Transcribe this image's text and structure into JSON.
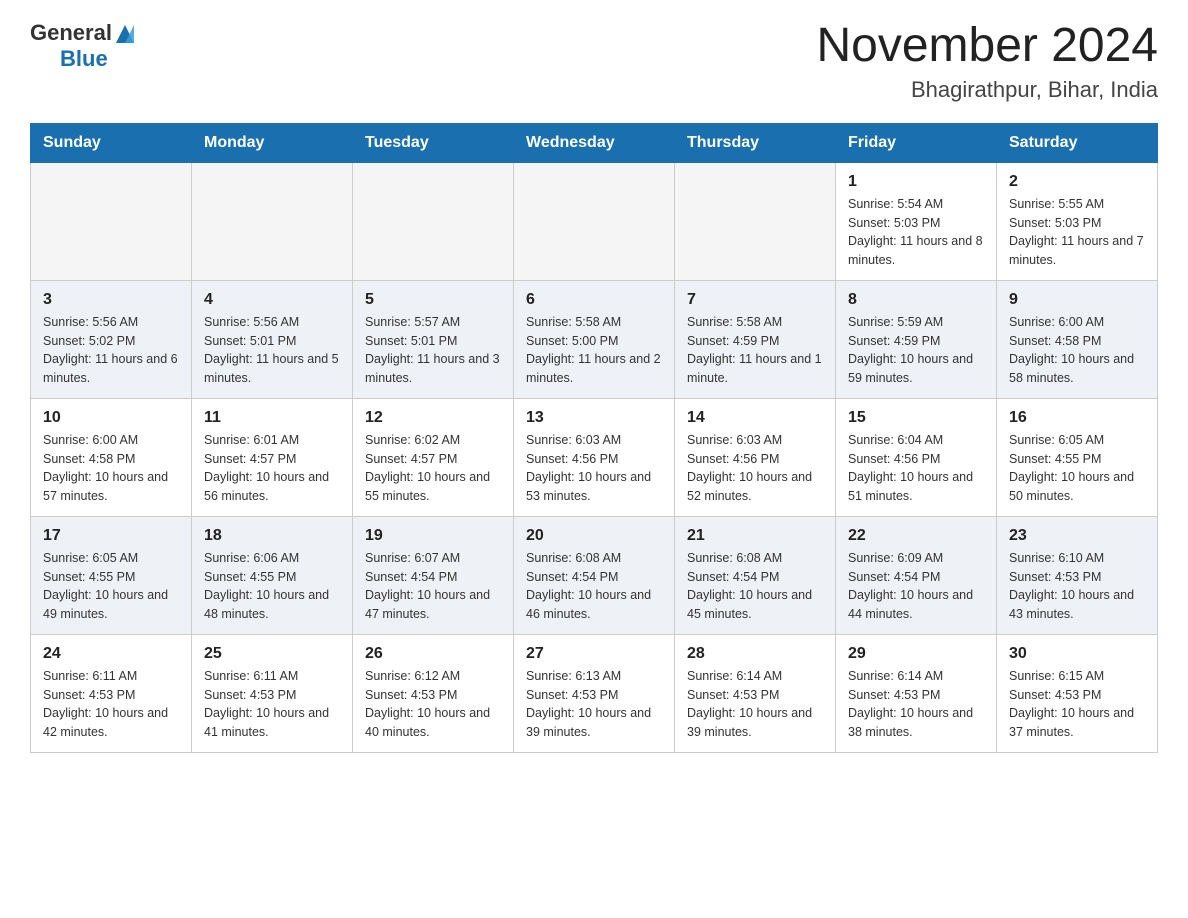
{
  "header": {
    "logo": {
      "general": "General",
      "blue": "Blue"
    },
    "title": "November 2024",
    "subtitle": "Bhagirathpur, Bihar, India"
  },
  "weekdays": [
    "Sunday",
    "Monday",
    "Tuesday",
    "Wednesday",
    "Thursday",
    "Friday",
    "Saturday"
  ],
  "weeks": [
    [
      {
        "day": "",
        "sunrise": "",
        "sunset": "",
        "daylight": ""
      },
      {
        "day": "",
        "sunrise": "",
        "sunset": "",
        "daylight": ""
      },
      {
        "day": "",
        "sunrise": "",
        "sunset": "",
        "daylight": ""
      },
      {
        "day": "",
        "sunrise": "",
        "sunset": "",
        "daylight": ""
      },
      {
        "day": "",
        "sunrise": "",
        "sunset": "",
        "daylight": ""
      },
      {
        "day": "1",
        "sunrise": "Sunrise: 5:54 AM",
        "sunset": "Sunset: 5:03 PM",
        "daylight": "Daylight: 11 hours and 8 minutes."
      },
      {
        "day": "2",
        "sunrise": "Sunrise: 5:55 AM",
        "sunset": "Sunset: 5:03 PM",
        "daylight": "Daylight: 11 hours and 7 minutes."
      }
    ],
    [
      {
        "day": "3",
        "sunrise": "Sunrise: 5:56 AM",
        "sunset": "Sunset: 5:02 PM",
        "daylight": "Daylight: 11 hours and 6 minutes."
      },
      {
        "day": "4",
        "sunrise": "Sunrise: 5:56 AM",
        "sunset": "Sunset: 5:01 PM",
        "daylight": "Daylight: 11 hours and 5 minutes."
      },
      {
        "day": "5",
        "sunrise": "Sunrise: 5:57 AM",
        "sunset": "Sunset: 5:01 PM",
        "daylight": "Daylight: 11 hours and 3 minutes."
      },
      {
        "day": "6",
        "sunrise": "Sunrise: 5:58 AM",
        "sunset": "Sunset: 5:00 PM",
        "daylight": "Daylight: 11 hours and 2 minutes."
      },
      {
        "day": "7",
        "sunrise": "Sunrise: 5:58 AM",
        "sunset": "Sunset: 4:59 PM",
        "daylight": "Daylight: 11 hours and 1 minute."
      },
      {
        "day": "8",
        "sunrise": "Sunrise: 5:59 AM",
        "sunset": "Sunset: 4:59 PM",
        "daylight": "Daylight: 10 hours and 59 minutes."
      },
      {
        "day": "9",
        "sunrise": "Sunrise: 6:00 AM",
        "sunset": "Sunset: 4:58 PM",
        "daylight": "Daylight: 10 hours and 58 minutes."
      }
    ],
    [
      {
        "day": "10",
        "sunrise": "Sunrise: 6:00 AM",
        "sunset": "Sunset: 4:58 PM",
        "daylight": "Daylight: 10 hours and 57 minutes."
      },
      {
        "day": "11",
        "sunrise": "Sunrise: 6:01 AM",
        "sunset": "Sunset: 4:57 PM",
        "daylight": "Daylight: 10 hours and 56 minutes."
      },
      {
        "day": "12",
        "sunrise": "Sunrise: 6:02 AM",
        "sunset": "Sunset: 4:57 PM",
        "daylight": "Daylight: 10 hours and 55 minutes."
      },
      {
        "day": "13",
        "sunrise": "Sunrise: 6:03 AM",
        "sunset": "Sunset: 4:56 PM",
        "daylight": "Daylight: 10 hours and 53 minutes."
      },
      {
        "day": "14",
        "sunrise": "Sunrise: 6:03 AM",
        "sunset": "Sunset: 4:56 PM",
        "daylight": "Daylight: 10 hours and 52 minutes."
      },
      {
        "day": "15",
        "sunrise": "Sunrise: 6:04 AM",
        "sunset": "Sunset: 4:56 PM",
        "daylight": "Daylight: 10 hours and 51 minutes."
      },
      {
        "day": "16",
        "sunrise": "Sunrise: 6:05 AM",
        "sunset": "Sunset: 4:55 PM",
        "daylight": "Daylight: 10 hours and 50 minutes."
      }
    ],
    [
      {
        "day": "17",
        "sunrise": "Sunrise: 6:05 AM",
        "sunset": "Sunset: 4:55 PM",
        "daylight": "Daylight: 10 hours and 49 minutes."
      },
      {
        "day": "18",
        "sunrise": "Sunrise: 6:06 AM",
        "sunset": "Sunset: 4:55 PM",
        "daylight": "Daylight: 10 hours and 48 minutes."
      },
      {
        "day": "19",
        "sunrise": "Sunrise: 6:07 AM",
        "sunset": "Sunset: 4:54 PM",
        "daylight": "Daylight: 10 hours and 47 minutes."
      },
      {
        "day": "20",
        "sunrise": "Sunrise: 6:08 AM",
        "sunset": "Sunset: 4:54 PM",
        "daylight": "Daylight: 10 hours and 46 minutes."
      },
      {
        "day": "21",
        "sunrise": "Sunrise: 6:08 AM",
        "sunset": "Sunset: 4:54 PM",
        "daylight": "Daylight: 10 hours and 45 minutes."
      },
      {
        "day": "22",
        "sunrise": "Sunrise: 6:09 AM",
        "sunset": "Sunset: 4:54 PM",
        "daylight": "Daylight: 10 hours and 44 minutes."
      },
      {
        "day": "23",
        "sunrise": "Sunrise: 6:10 AM",
        "sunset": "Sunset: 4:53 PM",
        "daylight": "Daylight: 10 hours and 43 minutes."
      }
    ],
    [
      {
        "day": "24",
        "sunrise": "Sunrise: 6:11 AM",
        "sunset": "Sunset: 4:53 PM",
        "daylight": "Daylight: 10 hours and 42 minutes."
      },
      {
        "day": "25",
        "sunrise": "Sunrise: 6:11 AM",
        "sunset": "Sunset: 4:53 PM",
        "daylight": "Daylight: 10 hours and 41 minutes."
      },
      {
        "day": "26",
        "sunrise": "Sunrise: 6:12 AM",
        "sunset": "Sunset: 4:53 PM",
        "daylight": "Daylight: 10 hours and 40 minutes."
      },
      {
        "day": "27",
        "sunrise": "Sunrise: 6:13 AM",
        "sunset": "Sunset: 4:53 PM",
        "daylight": "Daylight: 10 hours and 39 minutes."
      },
      {
        "day": "28",
        "sunrise": "Sunrise: 6:14 AM",
        "sunset": "Sunset: 4:53 PM",
        "daylight": "Daylight: 10 hours and 39 minutes."
      },
      {
        "day": "29",
        "sunrise": "Sunrise: 6:14 AM",
        "sunset": "Sunset: 4:53 PM",
        "daylight": "Daylight: 10 hours and 38 minutes."
      },
      {
        "day": "30",
        "sunrise": "Sunrise: 6:15 AM",
        "sunset": "Sunset: 4:53 PM",
        "daylight": "Daylight: 10 hours and 37 minutes."
      }
    ]
  ]
}
